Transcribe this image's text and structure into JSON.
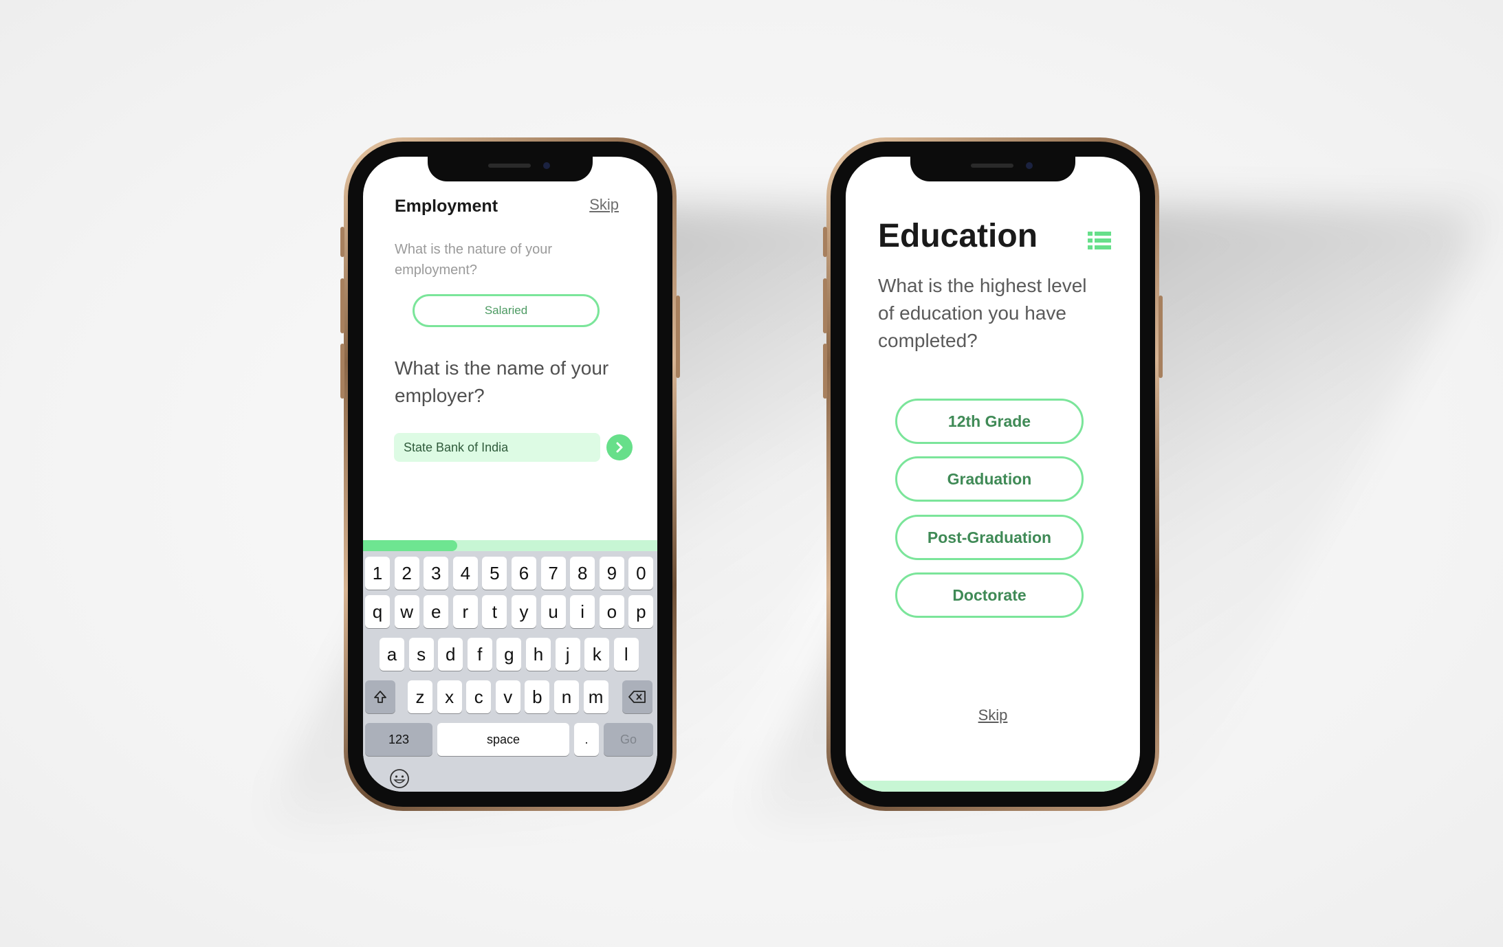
{
  "employment_screen": {
    "title": "Employment",
    "skip_label": "Skip",
    "question_nature": "What is the nature of your employment?",
    "nature_selected": "Salaried",
    "question_employer": "What is the name of your employer?",
    "employer_input_value": "State Bank of India",
    "progress_fraction": 0.32,
    "keyboard": {
      "row_numbers": [
        "1",
        "2",
        "3",
        "4",
        "5",
        "6",
        "7",
        "8",
        "9",
        "0"
      ],
      "row_q": [
        "q",
        "w",
        "e",
        "r",
        "t",
        "y",
        "u",
        "i",
        "o",
        "p"
      ],
      "row_a": [
        "a",
        "s",
        "d",
        "f",
        "g",
        "h",
        "j",
        "k",
        "l"
      ],
      "row_z": [
        "z",
        "x",
        "c",
        "v",
        "b",
        "n",
        "m"
      ],
      "numbers_label": "123",
      "space_label": "space",
      "period_label": ".",
      "go_label": "Go"
    }
  },
  "education_screen": {
    "title": "Education",
    "question": "What is the highest level of education you have completed?",
    "options": [
      "12th Grade",
      "Graduation",
      "Post-Graduation",
      "Doctorate"
    ],
    "skip_label": "Skip"
  },
  "colors": {
    "accent_green": "#67df8a",
    "pill_border": "#7be59a",
    "input_bg": "#ddfbe4",
    "progress_track": "#c7f6d4"
  }
}
